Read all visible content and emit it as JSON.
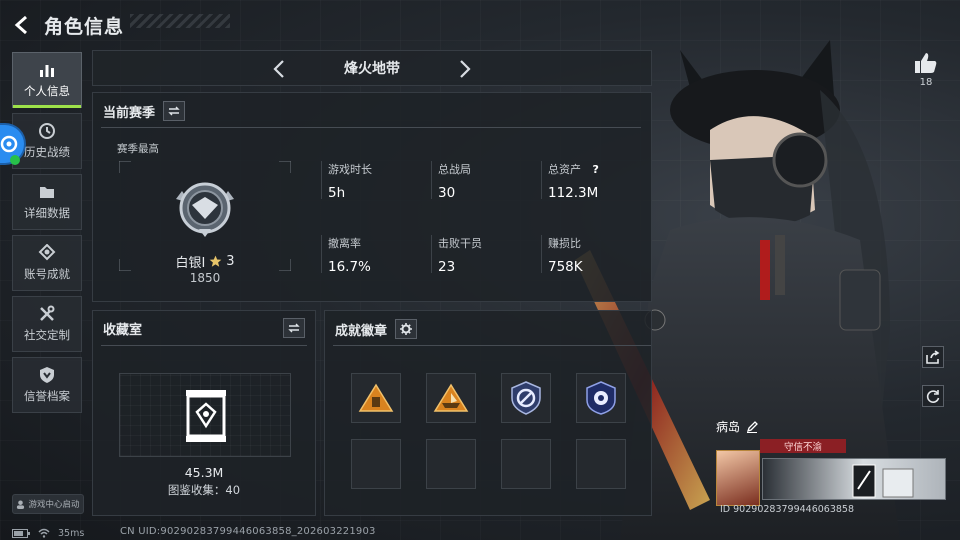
{
  "header": {
    "title": "角色信息"
  },
  "sidebar": {
    "items": [
      {
        "label": "个人信息",
        "icon": "bar-chart-icon",
        "active": true
      },
      {
        "label": "历史战绩",
        "icon": "clock-icon",
        "active": false
      },
      {
        "label": "详细数据",
        "icon": "folder-icon",
        "active": false
      },
      {
        "label": "账号成就",
        "icon": "achievement-icon",
        "active": false
      },
      {
        "label": "社交定制",
        "icon": "tools-icon",
        "active": false
      },
      {
        "label": "信誉档案",
        "icon": "shield-icon",
        "active": false
      }
    ],
    "game_center": "游戏中心启动"
  },
  "status": {
    "ping": "35ms",
    "uid": "CN UID:90290283799446063858_202603221903"
  },
  "map_selector": {
    "title": "烽火地带"
  },
  "season": {
    "title": "当前赛季",
    "best_label": "赛季最高",
    "rank_name": "白银Ⅰ",
    "rank_stars": "3",
    "rank_points": "1850",
    "stats": [
      {
        "label": "游戏时长",
        "value": "5h"
      },
      {
        "label": "总战局",
        "value": "30"
      },
      {
        "label": "总资产",
        "value": "112.3M",
        "help": "?"
      },
      {
        "label": "撤离率",
        "value": "16.7%"
      },
      {
        "label": "击败干员",
        "value": "23"
      },
      {
        "label": "赚损比",
        "value": "758K"
      }
    ]
  },
  "collection": {
    "title": "收藏室",
    "value": "45.3M",
    "count_label": "图鉴收集：40"
  },
  "badges": {
    "title": "成就徽章",
    "items": [
      "triangle-badge-icon",
      "ship-badge-icon",
      "shield-ring-badge-icon",
      "police-badge-icon",
      "",
      "",
      "",
      ""
    ]
  },
  "profile": {
    "likes": "18",
    "name": "病岛",
    "credit": "守信不渝",
    "card_uid": "ID 90290283799446063858"
  },
  "colors": {
    "accent": "#9ee24a",
    "credit": "#8b1f24",
    "float_button": "#2a8cf0"
  }
}
